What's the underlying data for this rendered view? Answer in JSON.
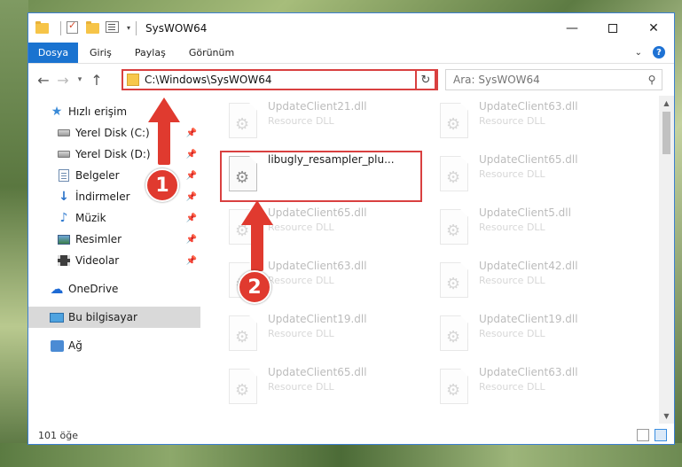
{
  "window": {
    "title": "SysWOW64",
    "minimize_glyph": "—",
    "close_glyph": "✕"
  },
  "ribbon": {
    "tabs": [
      {
        "label": "Dosya",
        "active": true
      },
      {
        "label": "Giriş"
      },
      {
        "label": "Paylaş"
      },
      {
        "label": "Görünüm"
      }
    ],
    "help_glyph": "?"
  },
  "address": {
    "path": "C:\\Windows\\SysWOW64",
    "search_placeholder": "Ara: SysWOW64"
  },
  "sidebar": {
    "items": [
      {
        "label": "Hızlı erişim",
        "icon": "star-icon",
        "pinned": false
      },
      {
        "label": "Yerel Disk (C:)",
        "icon": "disk-icon",
        "pinned": true
      },
      {
        "label": "Yerel Disk (D:)",
        "icon": "disk-icon",
        "pinned": true
      },
      {
        "label": "Belgeler",
        "icon": "documents-icon",
        "pinned": true
      },
      {
        "label": "İndirmeler",
        "icon": "download-icon",
        "pinned": true
      },
      {
        "label": "Müzik",
        "icon": "music-icon",
        "pinned": true
      },
      {
        "label": "Resimler",
        "icon": "pictures-icon",
        "pinned": true
      },
      {
        "label": "Videolar",
        "icon": "videos-icon",
        "pinned": true
      },
      {
        "label": "OneDrive",
        "icon": "cloud-icon"
      },
      {
        "label": "Bu bilgisayar",
        "icon": "computer-icon",
        "selected": true
      },
      {
        "label": "Ağ",
        "icon": "network-icon"
      }
    ]
  },
  "files": [
    {
      "name": "UpdateClient21.dll",
      "type": "Resource DLL",
      "faded": true
    },
    {
      "name": "UpdateClient63.dll",
      "type": "Resource DLL",
      "faded": true
    },
    {
      "name": "libugly_resampler_plu...",
      "type": "",
      "faded": false,
      "selected": true
    },
    {
      "name": "UpdateClient65.dll",
      "type": "Resource DLL",
      "faded": true
    },
    {
      "name": "UpdateClient65.dll",
      "type": "Resource DLL",
      "faded": true
    },
    {
      "name": "UpdateClient5.dll",
      "type": "Resource DLL",
      "faded": true
    },
    {
      "name": "UpdateClient63.dll",
      "type": "Resource DLL",
      "faded": true
    },
    {
      "name": "UpdateClient42.dll",
      "type": "Resource DLL",
      "faded": true
    },
    {
      "name": "UpdateClient19.dll",
      "type": "Resource DLL",
      "faded": true
    },
    {
      "name": "UpdateClient19.dll",
      "type": "Resource DLL",
      "faded": true
    },
    {
      "name": "UpdateClient65.dll",
      "type": "Resource DLL",
      "faded": true
    },
    {
      "name": "UpdateClient63.dll",
      "type": "Resource DLL",
      "faded": true
    }
  ],
  "status": {
    "item_count": "101 öğe"
  },
  "annotations": {
    "step1": "1",
    "step2": "2",
    "color": "#e03a2f"
  },
  "colors": {
    "accent": "#1a73d0",
    "highlight_border": "#d94040"
  }
}
